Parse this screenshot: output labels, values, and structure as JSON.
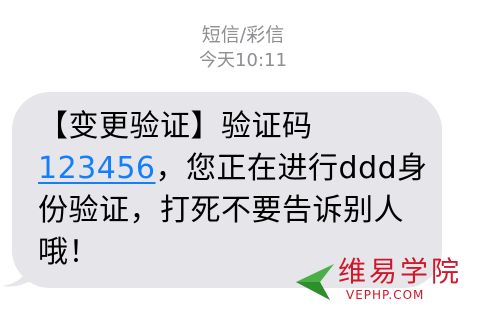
{
  "header": {
    "line1": "短信/彩信",
    "line2": "今天10:11"
  },
  "message": {
    "part1": "【变更验证】验证码",
    "code": "123456",
    "part2": "，您正在进行ddd身份验证，打死不要告诉别人哦！"
  },
  "watermark": {
    "name": "维易学院",
    "url": "VEPHP.COM"
  },
  "colors": {
    "bubble": "#e5e5ea",
    "link": "#147efb",
    "timestamp": "#8e8e93",
    "watermark_red": "#d0182a",
    "watermark_green": "#39a935"
  }
}
